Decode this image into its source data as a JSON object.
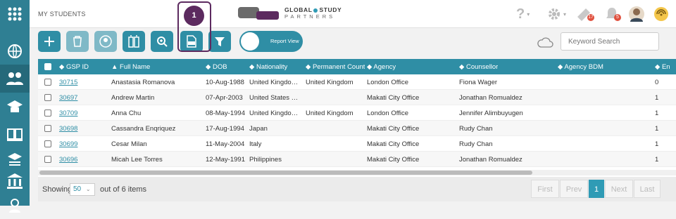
{
  "breadcrumb": "MY STUDENTS",
  "logo": {
    "line1a": "GLOBAL",
    "line1b": "STUDY",
    "line2": "PARTNERS"
  },
  "header": {
    "notif_count_1": "17",
    "notif_count_2": "5",
    "help_icon": "?"
  },
  "step_badge": "1",
  "toolbar": {
    "report_view_label": "Report View"
  },
  "search": {
    "placeholder": "Keyword Search"
  },
  "colors": {
    "sidebar": "#2f7f93",
    "accent": "#2f8ea5",
    "step": "#5c2a5f"
  },
  "table": {
    "columns": [
      "GSP ID",
      "Full Name",
      "DOB",
      "Nationality",
      "Permanent Count",
      "Agency",
      "Counsellor",
      "Agency BDM",
      "En"
    ],
    "rows": [
      [
        "30715",
        "Anastasia Romanova",
        "10-Aug-1988",
        "United Kingdo…",
        "United Kingdom",
        "London Office",
        "Fiona Wager",
        "",
        "0"
      ],
      [
        "30697",
        "Andrew Martin",
        "07-Apr-2003",
        "United States …",
        "",
        "Makati City Office",
        "Jonathan Romualdez",
        "",
        "1"
      ],
      [
        "30709",
        "Anna Chu",
        "08-May-1994",
        "United Kingdo…",
        "United Kingdom",
        "London Office",
        "Jennifer Alimbuyugen",
        "",
        "1"
      ],
      [
        "30698",
        "Cassandra Enqriquez",
        "17-Aug-1994",
        "Japan",
        "",
        "Makati City Office",
        "Rudy Chan",
        "",
        "1"
      ],
      [
        "30699",
        "Cesar Milan",
        "11-May-2004",
        "Italy",
        "",
        "Makati City Office",
        "Rudy Chan",
        "",
        "1"
      ],
      [
        "30696",
        "Micah Lee Torres",
        "12-May-1991",
        "Philippines",
        "",
        "Makati City Office",
        "Jonathan Romualdez",
        "",
        "1"
      ]
    ]
  },
  "footer": {
    "showing": "Showing",
    "page_size": "50",
    "suffix": "out of 6 items"
  },
  "pager": {
    "first": "First",
    "prev": "Prev",
    "current": "1",
    "next": "Next",
    "last": "Last"
  }
}
